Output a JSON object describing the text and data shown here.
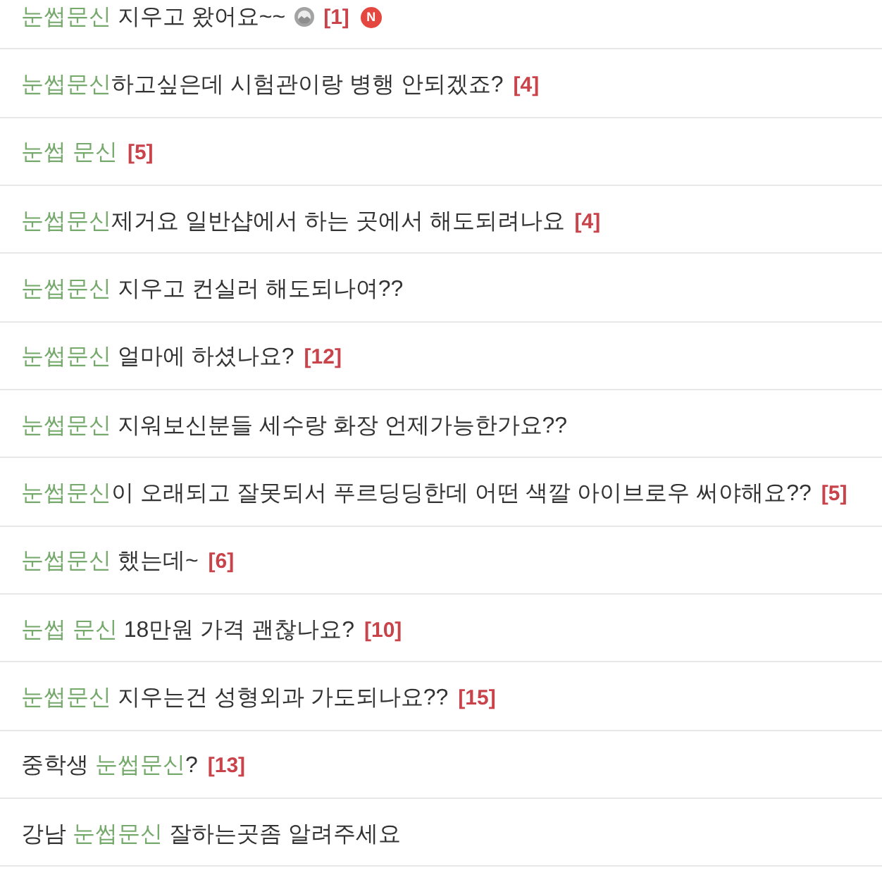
{
  "posts": [
    {
      "title": [
        {
          "text": "눈썹문신",
          "highlight": true
        },
        {
          "text": " 지우고 왔어요~~",
          "highlight": false
        }
      ],
      "photo": true,
      "comments": "[1]",
      "new_badge": "N"
    },
    {
      "title": [
        {
          "text": "눈썹문신",
          "highlight": true
        },
        {
          "text": "하고싶은데 시험관이랑 병행 안되겠죠?",
          "highlight": false
        }
      ],
      "photo": false,
      "comments": "[4]"
    },
    {
      "title": [
        {
          "text": "눈썹 문신",
          "highlight": true
        }
      ],
      "photo": false,
      "comments": "[5]"
    },
    {
      "title": [
        {
          "text": "눈썹문신",
          "highlight": true
        },
        {
          "text": "제거요 일반샵에서 하는 곳에서 해도되려나요",
          "highlight": false
        }
      ],
      "photo": false,
      "comments": "[4]"
    },
    {
      "title": [
        {
          "text": "눈썹문신",
          "highlight": true
        },
        {
          "text": " 지우고 컨실러 해도되나여??",
          "highlight": false
        }
      ],
      "photo": false
    },
    {
      "title": [
        {
          "text": "눈썹문신",
          "highlight": true
        },
        {
          "text": " 얼마에 하셨나요?",
          "highlight": false
        }
      ],
      "photo": false,
      "comments": "[12]"
    },
    {
      "title": [
        {
          "text": "눈썹문신",
          "highlight": true
        },
        {
          "text": " 지워보신분들 세수랑 화장 언제가능한가요??",
          "highlight": false
        }
      ],
      "photo": false
    },
    {
      "title": [
        {
          "text": "눈썹문신",
          "highlight": true
        },
        {
          "text": "이 오래되고 잘못되서 푸르딩딩한데 어떤 색깔 아이브로우 써야해요??",
          "highlight": false
        }
      ],
      "photo": false,
      "comments": "[5]"
    },
    {
      "title": [
        {
          "text": "눈썹문신",
          "highlight": true
        },
        {
          "text": " 했는데~",
          "highlight": false
        }
      ],
      "photo": false,
      "comments": "[6]"
    },
    {
      "title": [
        {
          "text": "눈썹 문신",
          "highlight": true
        },
        {
          "text": " 18만원 가격 괜찮나요?",
          "highlight": false
        }
      ],
      "photo": false,
      "comments": "[10]"
    },
    {
      "title": [
        {
          "text": "눈썹문신",
          "highlight": true
        },
        {
          "text": " 지우는건 성형외과 가도되나요??",
          "highlight": false
        }
      ],
      "photo": false,
      "comments": "[15]"
    },
    {
      "title": [
        {
          "text": "중학생 ",
          "highlight": false
        },
        {
          "text": "눈썹문신",
          "highlight": true
        },
        {
          "text": "?",
          "highlight": false
        }
      ],
      "photo": false,
      "comments": "[13]"
    },
    {
      "title": [
        {
          "text": "강남 ",
          "highlight": false
        },
        {
          "text": "눈썹문신",
          "highlight": true
        },
        {
          "text": " 잘하는곳좀 알려주세요",
          "highlight": false
        }
      ],
      "photo": false
    }
  ]
}
